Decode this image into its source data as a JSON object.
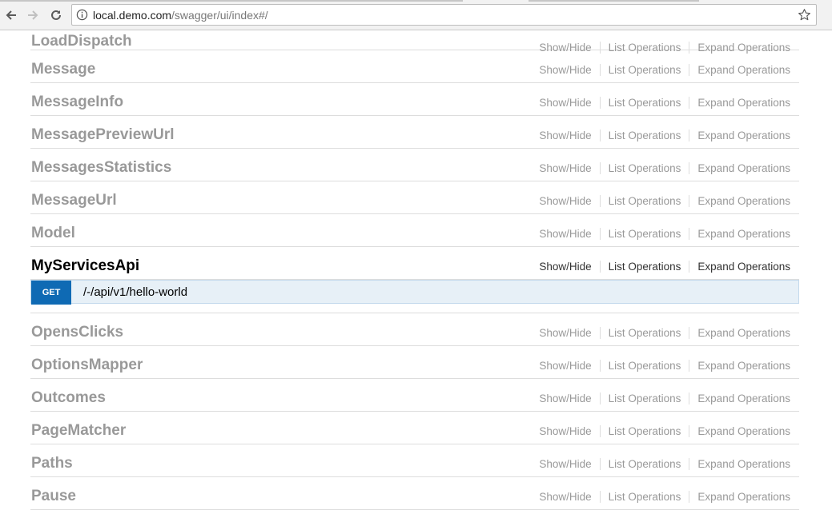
{
  "browser": {
    "url_host": "local.demo.com",
    "url_path": "/swagger/ui/index#/"
  },
  "resources_before": [
    {
      "name": "LoadDispatch"
    },
    {
      "name": "Message"
    },
    {
      "name": "MessageInfo"
    },
    {
      "name": "MessagePreviewUrl"
    },
    {
      "name": "MessagesStatistics"
    },
    {
      "name": "MessageUrl"
    },
    {
      "name": "Model"
    }
  ],
  "active_resource": {
    "name": "MyServicesApi",
    "operation": {
      "method": "GET",
      "path": "/-/api/v1/hello-world"
    }
  },
  "resources_after": [
    {
      "name": "OpensClicks"
    },
    {
      "name": "OptionsMapper"
    },
    {
      "name": "Outcomes"
    },
    {
      "name": "PageMatcher"
    },
    {
      "name": "Paths"
    },
    {
      "name": "Pause"
    }
  ],
  "ops_labels": {
    "show_hide": "Show/Hide",
    "list": "List Operations",
    "expand": "Expand Operations"
  },
  "colors": {
    "get_method": "#0f6ab4",
    "op_background": "#e7f0f7",
    "inactive_text": "#999999"
  }
}
